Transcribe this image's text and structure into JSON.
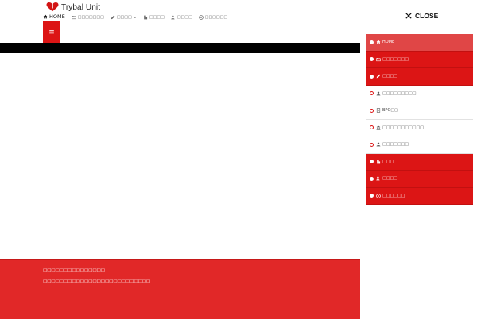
{
  "header": {
    "logo_text": "Trybal Unit",
    "nav": [
      {
        "label": "HOME",
        "icon": "home-icon",
        "active": true
      },
      {
        "label": "□□□□□□□",
        "icon": "folder-icon"
      },
      {
        "label": "□□□□",
        "icon": "pencil-icon",
        "has_dropdown": true
      },
      {
        "label": "□□□□",
        "icon": "building-icon"
      },
      {
        "label": "□□□□",
        "icon": "users-icon"
      },
      {
        "label": "□□□□□□",
        "icon": "globe-icon"
      }
    ],
    "menu_toggle_icon": "≡"
  },
  "footer": {
    "line1": "□□□□□□□□□□□□□□□",
    "line2": "□□□□□□□□□□□□□□□□□□□□□□□□□□"
  },
  "panel": {
    "close_label": "CLOSE",
    "items": [
      {
        "label": "HOME",
        "style": "red",
        "icon": "home-icon"
      },
      {
        "label": "□□□□□□□",
        "style": "red",
        "icon": "folder-icon"
      },
      {
        "label": "□□□□",
        "style": "red",
        "icon": "pencil-icon"
      },
      {
        "label": "□□□□□□□□□",
        "style": "white",
        "icon": "user-icon"
      },
      {
        "label": "BPO□□",
        "style": "white",
        "icon": "document-icon"
      },
      {
        "label": "□□□□□□□□□□□",
        "style": "white",
        "icon": "bank-icon"
      },
      {
        "label": "□□□□□□□",
        "style": "white",
        "icon": "person-icon"
      },
      {
        "label": "□□□□",
        "style": "red",
        "icon": "building-icon"
      },
      {
        "label": "□□□□",
        "style": "red",
        "icon": "users-icon"
      },
      {
        "label": "□□□□□□",
        "style": "red",
        "icon": "globe-icon"
      }
    ]
  },
  "colors": {
    "brand_red": "#dc1515",
    "footer_red": "#e12828",
    "highlight_red": "#e04646",
    "black_bar": "#000000"
  }
}
